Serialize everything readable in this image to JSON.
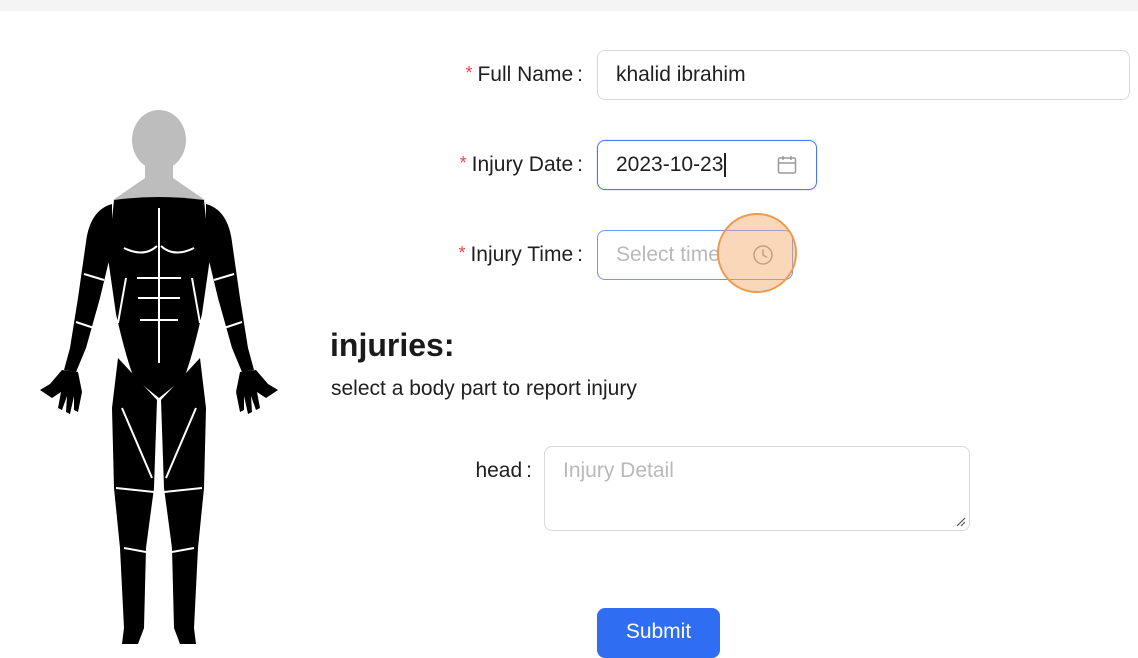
{
  "form": {
    "full_name": {
      "label": "Full Name",
      "required_mark": "*",
      "colon": ":",
      "value": "khalid ibrahim"
    },
    "injury_date": {
      "label": "Injury Date",
      "required_mark": "*",
      "colon": ":",
      "value": "2023-10-23",
      "icon": "calendar-icon"
    },
    "injury_time": {
      "label": "Injury Time",
      "required_mark": "*",
      "colon": ":",
      "placeholder": "Select time",
      "icon": "clock-icon"
    }
  },
  "injuries": {
    "heading": "injuries:",
    "instruction": "select a body part to report injury",
    "fields": [
      {
        "label": "head",
        "colon": ":",
        "placeholder": "Injury Detail"
      }
    ]
  },
  "submit_label": "Submit",
  "colors": {
    "primary": "#2f6ef3",
    "focus_border": "#4a78f0",
    "required": "#e5484d",
    "head_highlight": "#bdbdbd",
    "body": "#000000",
    "click_indicator": "#ee9a4d"
  }
}
